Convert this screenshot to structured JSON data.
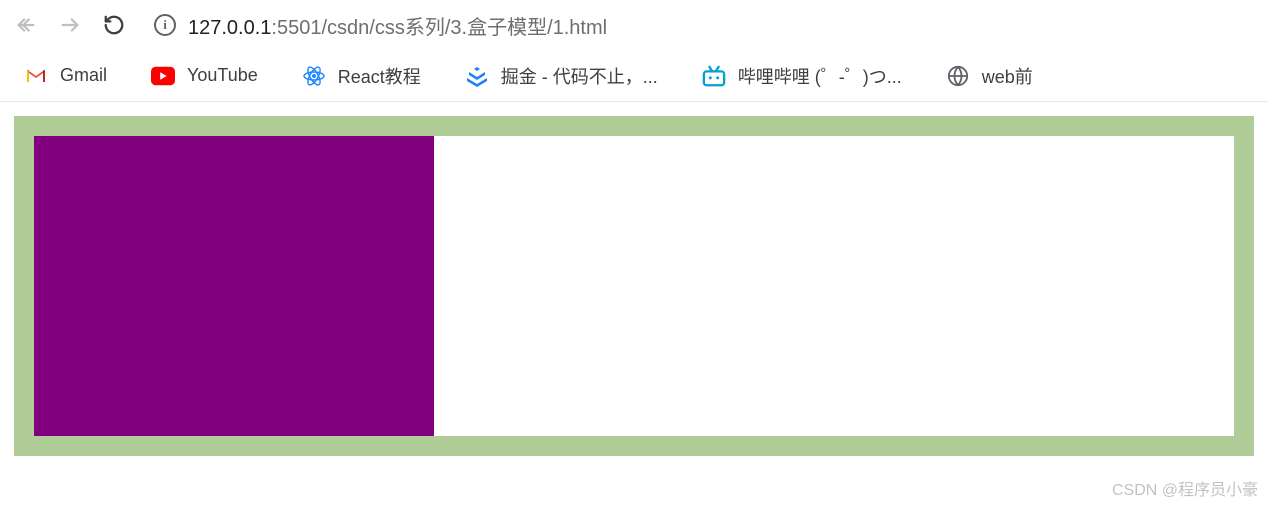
{
  "address": {
    "host": "127.0.0.1",
    "rest": ":5501/csdn/css系列/3.盒子模型/1.html"
  },
  "bookmarks": {
    "gmail": "Gmail",
    "youtube": "YouTube",
    "react": "React教程",
    "juejin": "掘金 - 代码不止，...",
    "bilibili": "哔哩哔哩 (゜-゜)つ...",
    "webfront": "web前"
  },
  "watermark": "CSDN @程序员小豪",
  "colors": {
    "outer": "#b0cd98",
    "inner": "#ffffff",
    "box": "#800080"
  }
}
